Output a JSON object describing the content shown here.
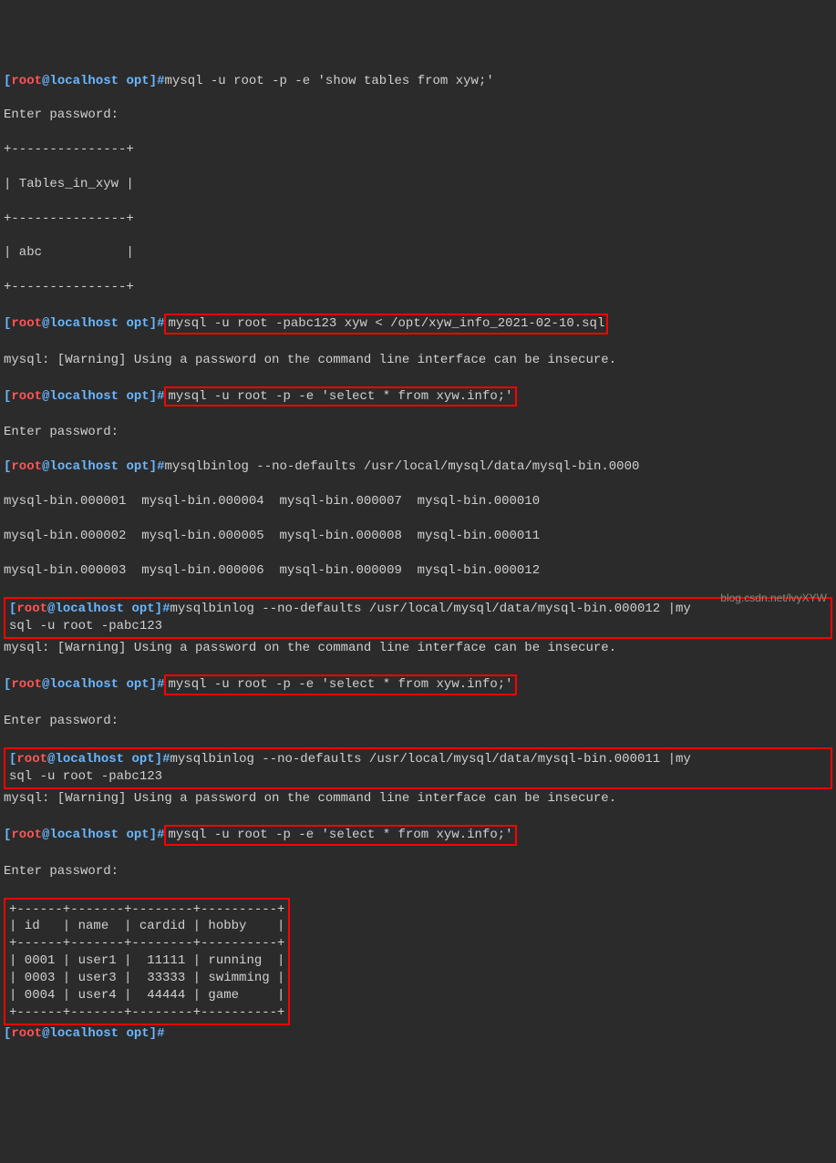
{
  "prompt": {
    "user": "root",
    "host": "localhost",
    "path": "opt",
    "symbol": "#"
  },
  "commands": {
    "show_tables": "mysql -u root -p -e 'show tables from xyw;'",
    "enter_password": "Enter password:",
    "restore_cmd": "mysql -u root -pabc123 xyw < /opt/xyw_info_2021-02-10.sql",
    "select_info": "mysql -u root -p -e 'select * from xyw.info;'",
    "mysqlbinlog_list": "mysqlbinlog --no-defaults /usr/local/mysql/data/mysql-bin.0000",
    "mysqlbinlog_12": "mysqlbinlog --no-defaults /usr/local/mysql/data/mysql-bin.000012 |my",
    "mysqlbinlog_11": "mysqlbinlog --no-defaults /usr/local/mysql/data/mysql-bin.000011 |my",
    "sql_continuation": "sql -u root -pabc123"
  },
  "output": {
    "tables_border": "+---------------+",
    "tables_header": "| Tables_in_xyw |",
    "tables_row": "| abc           |",
    "warning": "mysql: [Warning] Using a password on the command line interface can be insecure.",
    "binlog_row1": "mysql-bin.000001  mysql-bin.000004  mysql-bin.000007  mysql-bin.000010",
    "binlog_row2": "mysql-bin.000002  mysql-bin.000005  mysql-bin.000008  mysql-bin.000011",
    "binlog_row3": "mysql-bin.000003  mysql-bin.000006  mysql-bin.000009  mysql-bin.000012"
  },
  "chart_data": {
    "type": "table",
    "border_top": "+------+-------+--------+----------+",
    "header": "| id   | name  | cardid | hobby    |",
    "border_mid": "+------+-------+--------+----------+",
    "rows": [
      "| 0001 | user1 |  11111 | running  |",
      "| 0003 | user3 |  33333 | swimming |",
      "| 0004 | user4 |  44444 | game     |"
    ],
    "border_bot": "+------+-------+--------+----------+",
    "columns": [
      "id",
      "name",
      "cardid",
      "hobby"
    ],
    "data": [
      {
        "id": "0001",
        "name": "user1",
        "cardid": 11111,
        "hobby": "running"
      },
      {
        "id": "0003",
        "name": "user3",
        "cardid": 33333,
        "hobby": "swimming"
      },
      {
        "id": "0004",
        "name": "user4",
        "cardid": 44444,
        "hobby": "game"
      }
    ]
  },
  "watermark": "blog.csdn.net/lvyXYW"
}
